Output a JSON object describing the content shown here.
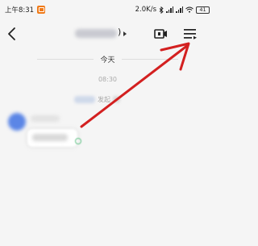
{
  "status_bar": {
    "time": "上午8:31",
    "net_speed": "2.0K/s",
    "signal_icon": "cellular-signal-icon",
    "wifi_icon": "wifi-icon",
    "battery": "41"
  },
  "nav_bar": {
    "back_icon": "chevron-left-icon",
    "title_suffix": ")",
    "video_icon": "video-call-icon",
    "menu_icon": "menu-lines-icon"
  },
  "chat": {
    "date_label": "今天",
    "time_label": "08:30",
    "system_message_visible": "发起",
    "system_message_tail": "聊"
  },
  "annotation": {
    "arrow_color": "#d32020"
  },
  "colors": {
    "background": "#f5f5f5",
    "avatar_blue": "#5b86e6",
    "status_green": "#66c48a",
    "app_badge_orange": "#f07a18"
  }
}
